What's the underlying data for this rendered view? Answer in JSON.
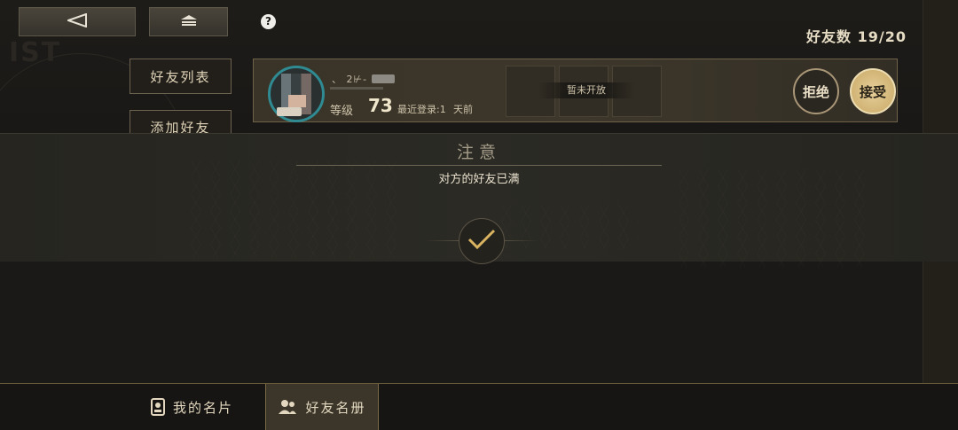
{
  "header": {
    "back_icon": "back-arrow-icon",
    "home_icon": "home-icon",
    "help_symbol": "?",
    "friend_count_label": "好友数",
    "friend_count_value": "19/20"
  },
  "background": {
    "watermark": "IST"
  },
  "side_menu": {
    "items": [
      {
        "label": "好友列表"
      },
      {
        "label": "添加好友"
      }
    ]
  },
  "friend_request": {
    "name": "、 2⊬-",
    "level_label": "等级",
    "level": "73",
    "last_login_label": "最近登录:1",
    "last_login_unit": "天前",
    "slots_banner": "暂未开放",
    "reject_label": "拒绝",
    "accept_label": "接受"
  },
  "notice": {
    "title": "注意",
    "message": "对方的好友已满",
    "confirm_icon": "checkmark-icon"
  },
  "bottom_tabs": [
    {
      "label": "我的名片",
      "icon": "id-card-icon"
    },
    {
      "label": "好友名册",
      "icon": "people-icon"
    }
  ],
  "colors": {
    "accent_gold": "#c8a865",
    "avatar_ring": "#2f8a92",
    "background": "#1b1a18"
  }
}
